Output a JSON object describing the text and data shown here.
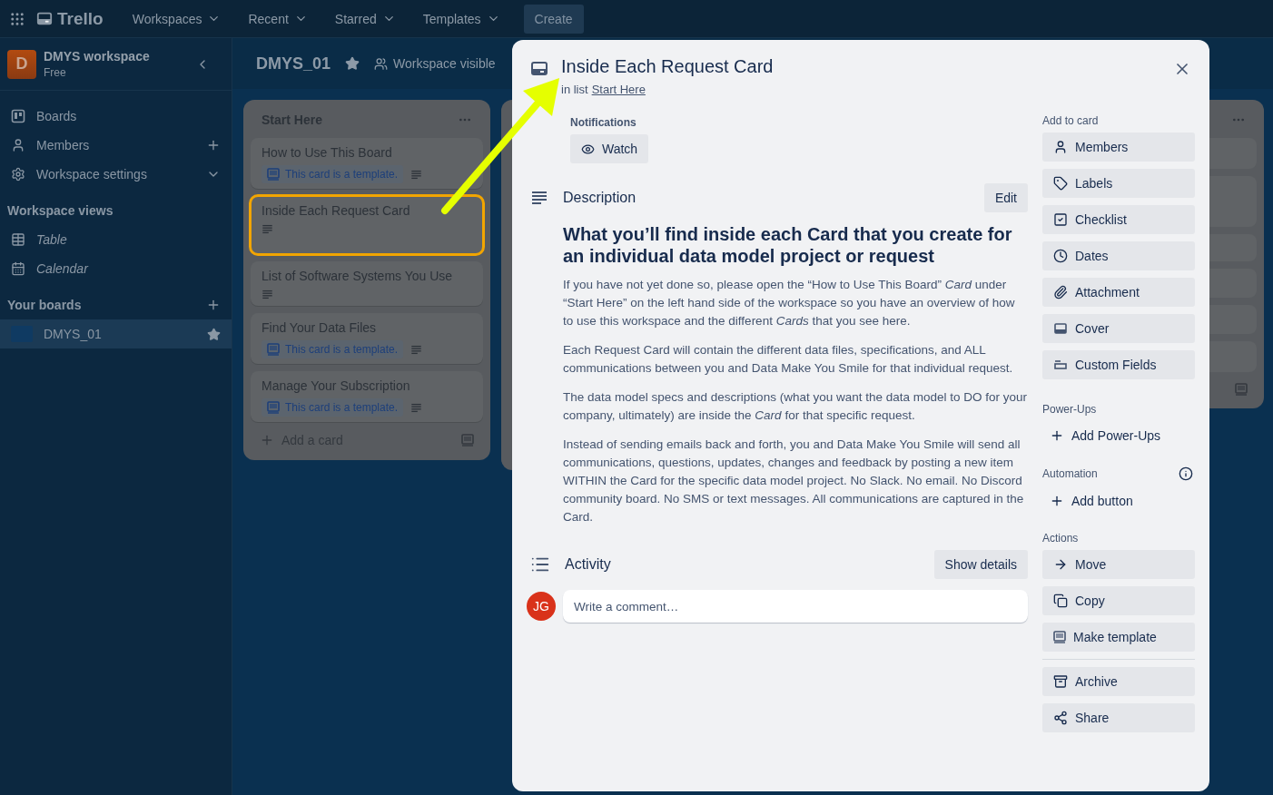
{
  "topbar": {
    "logo": "Trello",
    "menus": [
      "Workspaces",
      "Recent",
      "Starred",
      "Templates"
    ],
    "create": "Create"
  },
  "sidebar": {
    "workspace": {
      "initial": "D",
      "name": "DMYS workspace",
      "plan": "Free"
    },
    "nav": [
      {
        "label": "Boards",
        "kind": "boards"
      },
      {
        "label": "Members",
        "kind": "members"
      },
      {
        "label": "Workspace settings",
        "kind": "settings"
      }
    ],
    "views_title": "Workspace views",
    "views": [
      {
        "label": "Table",
        "kind": "table"
      },
      {
        "label": "Calendar",
        "kind": "calendar"
      }
    ],
    "boards_title": "Your boards",
    "boards": [
      {
        "name": "DMYS_01",
        "selected": true,
        "starred": true
      }
    ]
  },
  "board": {
    "title": "DMYS_01",
    "starred": true,
    "visibility": "Workspace visible",
    "list": {
      "title": "Start Here",
      "cards": [
        {
          "title": "How to Use This Board",
          "template_badge": "This card is a template.",
          "highlighted": false
        },
        {
          "title": "Inside Each Request Card",
          "highlighted": true
        },
        {
          "title": "List of Software Systems You Use",
          "highlighted": false
        },
        {
          "title": "Find Your Data Files",
          "template_badge": "This card is a template.",
          "highlighted": false
        },
        {
          "title": "Manage Your Subscription",
          "template_badge": "This card is a template.",
          "highlighted": false
        }
      ],
      "add_card": "Add a card"
    }
  },
  "card_modal": {
    "title": "Inside Each Request Card",
    "list_prefix": "in list",
    "list_name": "Start Here",
    "notifications_label": "Notifications",
    "watch": "Watch",
    "description_title": "Description",
    "edit": "Edit",
    "heading": "What you’ll find inside each Card that you create for an individual data model project or request",
    "paragraphs": [
      "If you have not yet done so, please open the “How to Use This Board” *Card* under “Start Here” on the left hand side of the workspace so you have an overview of how to use this workspace and the different *Cards* that you see here.",
      "Each Request Card will contain the different data files, specifications, and ALL communications between you and Data Make You Smile for that individual request.",
      "The data model specs and descriptions (what you want the data model to DO for your company, ultimately) are inside the *Card* for that specific request.",
      "Instead of sending emails back and forth, you and Data Make You Smile will send all communications, questions, updates, changes and feedback by posting a new item WITHIN the Card for the specific data model project. No Slack. No email. No Discord community board. No SMS or text messages. All communications are captured in the Card."
    ],
    "activity_title": "Activity",
    "show_details": "Show details",
    "avatar": "JG",
    "comment_placeholder": "Write a comment…",
    "add_to_card_title": "Add to card",
    "add_to_card": [
      {
        "label": "Members",
        "kind": "members"
      },
      {
        "label": "Labels",
        "kind": "labels"
      },
      {
        "label": "Checklist",
        "kind": "checklist"
      },
      {
        "label": "Dates",
        "kind": "dates"
      },
      {
        "label": "Attachment",
        "kind": "attachment"
      },
      {
        "label": "Cover",
        "kind": "cover"
      },
      {
        "label": "Custom Fields",
        "kind": "fields"
      }
    ],
    "powerups_title": "Power-Ups",
    "add_powerups": "Add Power-Ups",
    "automation_title": "Automation",
    "add_button": "Add button",
    "actions_title": "Actions",
    "actions": [
      {
        "label": "Move",
        "kind": "move"
      },
      {
        "label": "Copy",
        "kind": "copy"
      },
      {
        "label": "Make template",
        "kind": "template"
      },
      {
        "label": "Archive",
        "kind": "archive",
        "divider_before": true
      },
      {
        "label": "Share",
        "kind": "share"
      }
    ]
  }
}
